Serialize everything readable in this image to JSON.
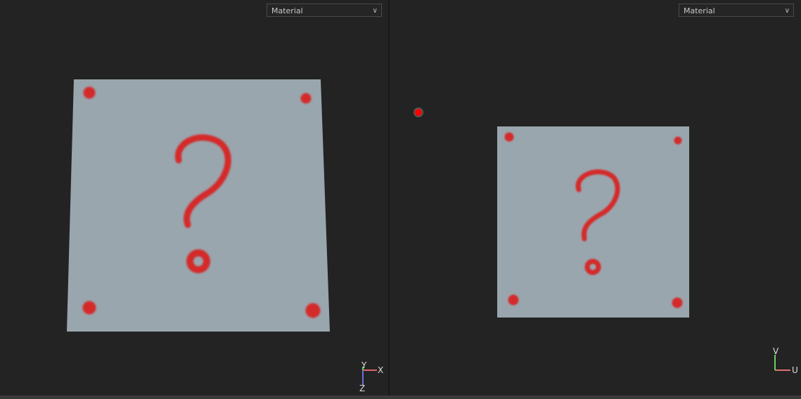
{
  "left_viewport": {
    "shading_dropdown": "Material",
    "gizmo": {
      "x_label": "X",
      "y_label": "Y",
      "z_label": "Z"
    }
  },
  "right_viewport": {
    "shading_dropdown": "Material",
    "gizmo": {
      "u_label": "U",
      "v_label": "V"
    }
  },
  "colors": {
    "background": "#232323",
    "texture": "#9aa6ae",
    "paint": "#d42a2a"
  }
}
